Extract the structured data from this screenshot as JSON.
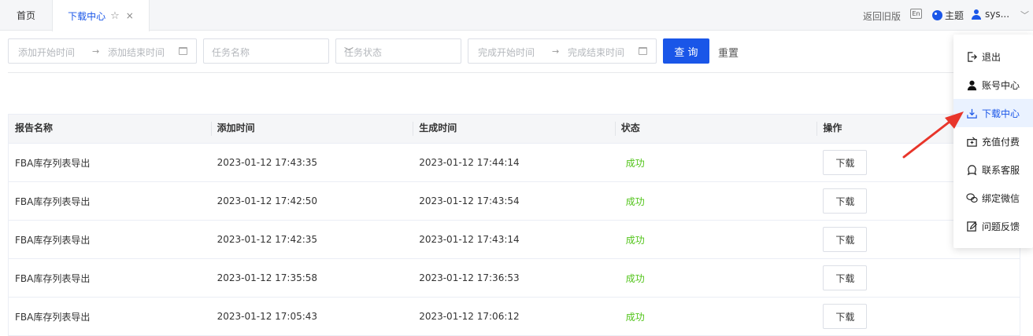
{
  "tabs": {
    "home": "首页",
    "active": "下载中心",
    "star": "☆",
    "close": "×"
  },
  "header": {
    "back_old": "返回旧版",
    "lang": "En",
    "theme": "主题",
    "user": "sys..."
  },
  "filters": {
    "add_start": "添加开始时间",
    "add_end": "添加结束时间",
    "task_name": "任务名称",
    "task_status": "任务状态",
    "done_start": "完成开始时间",
    "done_end": "完成结束时间",
    "query": "查 询",
    "reset": "重置"
  },
  "table": {
    "headers": [
      "报告名称",
      "添加时间",
      "生成时间",
      "状态",
      "操作"
    ],
    "rows": [
      {
        "name": "FBA库存列表导出",
        "added": "2023-01-12 17:43:35",
        "generated": "2023-01-12 17:44:14",
        "status": "成功",
        "action": "下载"
      },
      {
        "name": "FBA库存列表导出",
        "added": "2023-01-12 17:42:50",
        "generated": "2023-01-12 17:43:54",
        "status": "成功",
        "action": "下载"
      },
      {
        "name": "FBA库存列表导出",
        "added": "2023-01-12 17:42:35",
        "generated": "2023-01-12 17:43:14",
        "status": "成功",
        "action": "下载"
      },
      {
        "name": "FBA库存列表导出",
        "added": "2023-01-12 17:35:58",
        "generated": "2023-01-12 17:36:53",
        "status": "成功",
        "action": "下载"
      },
      {
        "name": "FBA库存列表导出",
        "added": "2023-01-12 17:05:43",
        "generated": "2023-01-12 17:06:12",
        "status": "成功",
        "action": "下载"
      }
    ]
  },
  "menu": {
    "items": [
      {
        "label": "退出",
        "icon": "logout-icon"
      },
      {
        "label": "账号中心",
        "icon": "user-icon"
      },
      {
        "label": "下载中心",
        "icon": "download-icon",
        "active": true
      },
      {
        "label": "充值付费",
        "icon": "recharge-icon"
      },
      {
        "label": "联系客服",
        "icon": "service-icon"
      },
      {
        "label": "绑定微信",
        "icon": "wechat-icon"
      },
      {
        "label": "问题反馈",
        "icon": "feedback-icon"
      }
    ]
  },
  "colors": {
    "primary": "#1a56e8",
    "success": "#52c41a",
    "arrow": "#e8352a"
  }
}
